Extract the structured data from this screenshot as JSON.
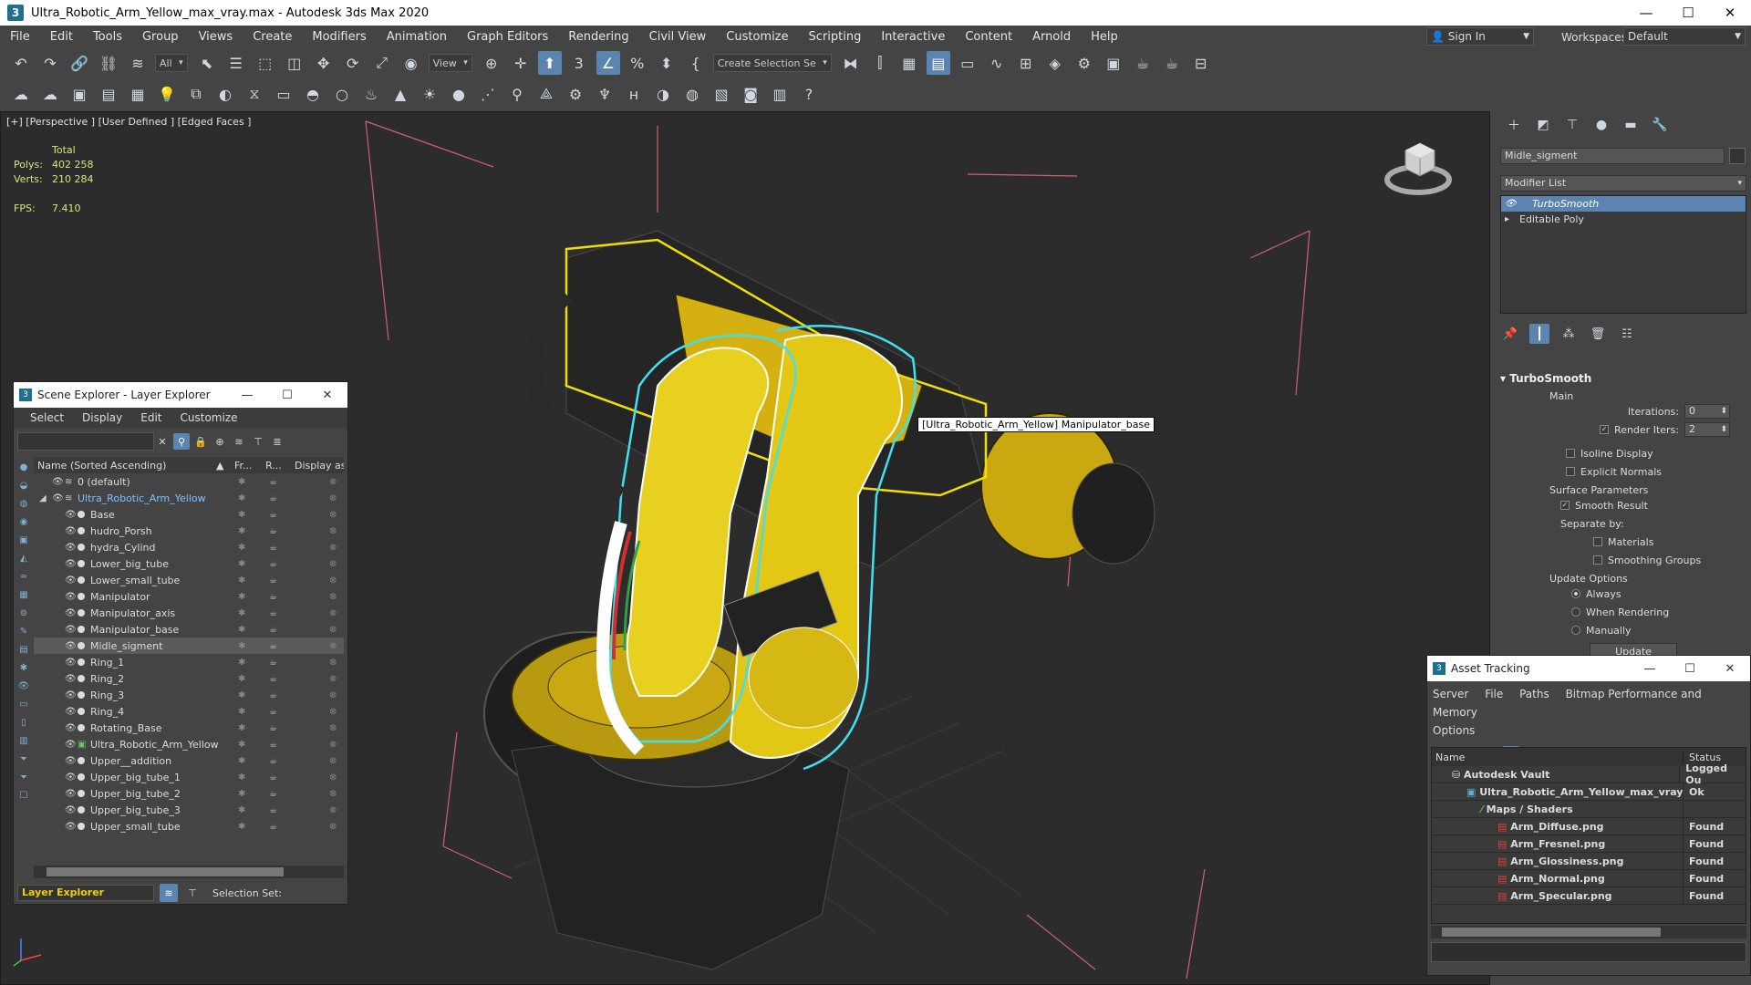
{
  "window": {
    "title": "Ultra_Robotic_Arm_Yellow_max_vray.max - Autodesk 3ds Max 2020",
    "app_icon": "3"
  },
  "menu": [
    "File",
    "Edit",
    "Tools",
    "Group",
    "Views",
    "Create",
    "Modifiers",
    "Animation",
    "Graph Editors",
    "Rendering",
    "Civil View",
    "Customize",
    "Scripting",
    "Interactive",
    "Content",
    "Arnold",
    "Help"
  ],
  "signin": "Sign In",
  "workspace": {
    "label": "Workspaces:",
    "value": "Default"
  },
  "toolbar": {
    "filter": "All",
    "refcoord": "View",
    "selection_set": "Create Selection Se"
  },
  "viewport": {
    "label": "[+] [Perspective ] [User Defined ] [Edged Faces ]",
    "stats": {
      "total_label": "Total",
      "polys_label": "Polys:",
      "polys": "402 258",
      "verts_label": "Verts:",
      "verts": "210 284",
      "fps_label": "FPS:",
      "fps": "7.410"
    },
    "tooltip": "[Ultra_Robotic_Arm_Yellow] Manipulator_base"
  },
  "command_panel": {
    "object_name": "Midle_sigment",
    "modifier_list": "Modifier List",
    "stack": [
      {
        "label": "TurboSmooth",
        "selected": true
      },
      {
        "label": "Editable Poly",
        "selected": false
      }
    ],
    "rollout": {
      "title": "TurboSmooth",
      "main": "Main",
      "iterations_label": "Iterations:",
      "iterations": "0",
      "render_iters_label": "Render Iters:",
      "render_iters": "2",
      "isoline": "Isoline Display",
      "explicit_normals": "Explicit Normals",
      "surface_params": "Surface Parameters",
      "smooth_result": "Smooth Result",
      "separate_by": "Separate by:",
      "materials": "Materials",
      "smoothing_groups": "Smoothing Groups",
      "update_options": "Update Options",
      "always": "Always",
      "when_rendering": "When Rendering",
      "manually": "Manually",
      "update_button": "Update"
    }
  },
  "scene_explorer": {
    "title": "Scene Explorer - Layer Explorer",
    "menu": [
      "Select",
      "Display",
      "Edit",
      "Customize"
    ],
    "columns": {
      "name": "Name (Sorted Ascending)",
      "frozen": "Fr...",
      "render": "R...",
      "display": "Display as Bo"
    },
    "rows": [
      {
        "name": "0 (default)",
        "level": 0,
        "type": "layer"
      },
      {
        "name": "Ultra_Robotic_Arm_Yellow",
        "level": 0,
        "type": "layer-open"
      },
      {
        "name": "Base",
        "level": 1
      },
      {
        "name": "hudro_Porsh",
        "level": 1
      },
      {
        "name": "hydra_Cylind",
        "level": 1
      },
      {
        "name": "Lower_big_tube",
        "level": 1
      },
      {
        "name": "Lower_small_tube",
        "level": 1
      },
      {
        "name": "Manipulator",
        "level": 1
      },
      {
        "name": "Manipulator_axis",
        "level": 1
      },
      {
        "name": "Manipulator_base",
        "level": 1
      },
      {
        "name": "Midle_sigment",
        "level": 1,
        "selected": true
      },
      {
        "name": "Ring_1",
        "level": 1
      },
      {
        "name": "Ring_2",
        "level": 1
      },
      {
        "name": "Ring_3",
        "level": 1
      },
      {
        "name": "Ring_4",
        "level": 1
      },
      {
        "name": "Rotating_Base",
        "level": 1
      },
      {
        "name": "Ultra_Robotic_Arm_Yellow",
        "level": 1
      },
      {
        "name": "Upper__addition",
        "level": 1
      },
      {
        "name": "Upper_big_tube_1",
        "level": 1
      },
      {
        "name": "Upper_big_tube_2",
        "level": 1
      },
      {
        "name": "Upper_big_tube_3",
        "level": 1
      },
      {
        "name": "Upper_small_tube",
        "level": 1
      }
    ],
    "footer_layer": "Layer Explorer",
    "selection_set_label": "Selection Set:"
  },
  "asset_tracking": {
    "title": "Asset Tracking",
    "menu": [
      "Server",
      "File",
      "Paths",
      "Bitmap Performance and Memory",
      "Options"
    ],
    "columns": {
      "name": "Name",
      "status": "Status"
    },
    "rows": [
      {
        "name": "Autodesk Vault",
        "status": "Logged Ou",
        "indent": 1
      },
      {
        "name": "Ultra_Robotic_Arm_Yellow_max_vray.max",
        "status": "Ok",
        "indent": 2
      },
      {
        "name": "Maps / Shaders",
        "status": "",
        "indent": 3
      },
      {
        "name": "Arm_Diffuse.png",
        "status": "Found",
        "indent": 4
      },
      {
        "name": "Arm_Fresnel.png",
        "status": "Found",
        "indent": 4
      },
      {
        "name": "Arm_Glossiness.png",
        "status": "Found",
        "indent": 4
      },
      {
        "name": "Arm_Normal.png",
        "status": "Found",
        "indent": 4
      },
      {
        "name": "Arm_Specular.png",
        "status": "Found",
        "indent": 4
      }
    ]
  }
}
